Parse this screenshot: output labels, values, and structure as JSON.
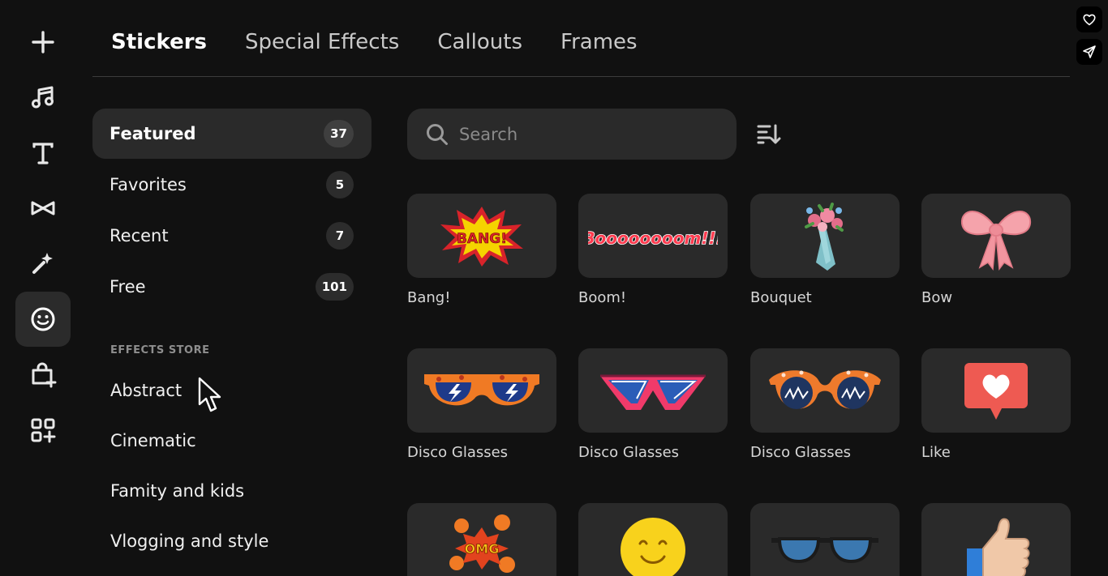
{
  "tabs": [
    {
      "label": "Stickers",
      "active": true
    },
    {
      "label": "Special Effects"
    },
    {
      "label": "Callouts"
    },
    {
      "label": "Frames"
    }
  ],
  "rail": {
    "icons": [
      "add-icon",
      "music-icon",
      "text-icon",
      "transitions-icon",
      "magic-wand-icon",
      "stickers-icon",
      "store-icon",
      "add-widget-icon"
    ],
    "active": "stickers-icon"
  },
  "categories": [
    {
      "label": "Featured",
      "count": "37",
      "active": true
    },
    {
      "label": "Favorites",
      "count": "5"
    },
    {
      "label": "Recent",
      "count": "7"
    },
    {
      "label": "Free",
      "count": "101"
    }
  ],
  "effects_store": {
    "heading": "EFFECTS STORE",
    "items": [
      "Abstract",
      "Cinematic",
      "Famity and kids",
      "Vlogging and style"
    ]
  },
  "search": {
    "placeholder": "Search",
    "value": ""
  },
  "sort_icon": "sort-descending-icon",
  "stickers": [
    {
      "label": "Bang!",
      "art_text": "BANG!"
    },
    {
      "label": "Boom!",
      "art_text": "Boooooooom!!!"
    },
    {
      "label": "Bouquet"
    },
    {
      "label": "Bow"
    },
    {
      "label": "Disco Glasses"
    },
    {
      "label": "Disco Glasses"
    },
    {
      "label": "Disco Glasses"
    },
    {
      "label": "Like"
    },
    {
      "label": "",
      "art_text": "OMG"
    },
    {
      "label": ""
    },
    {
      "label": ""
    },
    {
      "label": ""
    }
  ],
  "floating_buttons": [
    "heart-icon",
    "send-icon"
  ],
  "colors": {
    "background": "#111111",
    "panel": "#2a2a2a",
    "text": "#ffffff",
    "muted": "#8e8e8e"
  }
}
